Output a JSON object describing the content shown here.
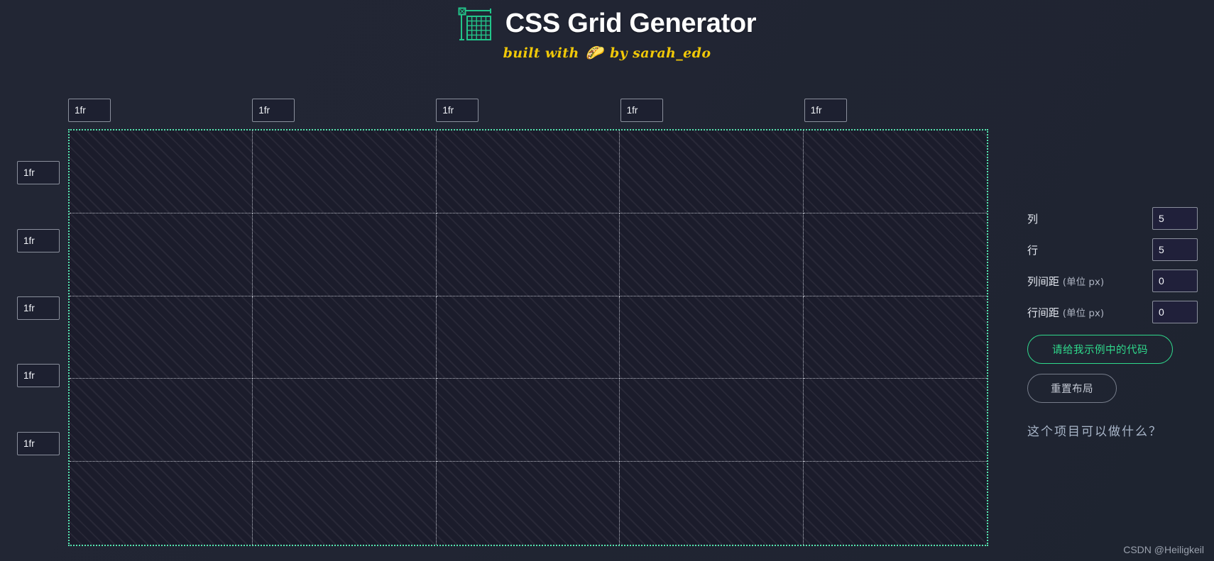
{
  "header": {
    "icon_name": "grid-icon",
    "title": "CSS Grid Generator",
    "subtitle_prefix": "built with",
    "subtitle_emoji": "🌮",
    "subtitle_suffix": "by sarah_edo"
  },
  "grid": {
    "column_tracks": [
      "1fr",
      "1fr",
      "1fr",
      "1fr",
      "1fr"
    ],
    "row_tracks": [
      "1fr",
      "1fr",
      "1fr",
      "1fr",
      "1fr"
    ],
    "columns": 5,
    "rows": 5,
    "track_placeholder": "1fr",
    "border_color": "#55e6b0",
    "cell_divider_color": "#b9bcc6",
    "cell_background": "#1b1c2b"
  },
  "controls": {
    "fields": [
      {
        "label": "列",
        "unit": "",
        "value": "5",
        "name": "columns-input"
      },
      {
        "label": "行",
        "unit": "",
        "value": "5",
        "name": "rows-input"
      },
      {
        "label": "列间距",
        "unit": "(单位 px)",
        "value": "0",
        "name": "column-gap-input"
      },
      {
        "label": "行间距",
        "unit": "(单位 px)",
        "value": "0",
        "name": "row-gap-input"
      }
    ],
    "example_button": "请给我示例中的代码",
    "reset_button": "重置布局",
    "what_link": "这个项目可以做什么？",
    "accent_color": "#2fd98c",
    "muted_color": "#c4c9d4"
  },
  "watermark": "CSDN @Heiligkeil"
}
